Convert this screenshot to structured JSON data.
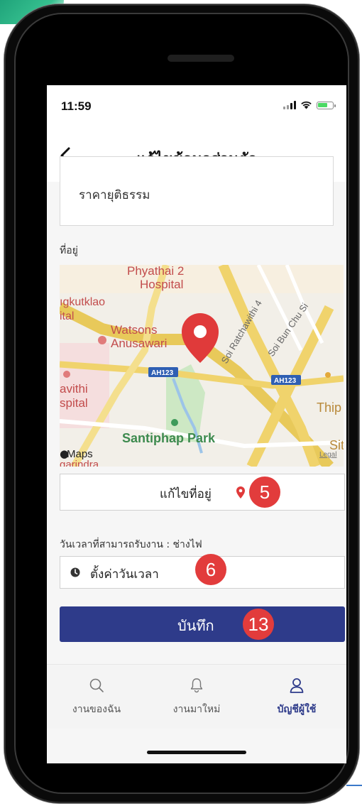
{
  "status_bar": {
    "time": "11:59",
    "battery_level": 0.7
  },
  "header": {
    "title": "แก้ไขข้อมูลส่วนตัว",
    "back_icon": "chevron-left-icon"
  },
  "description_box": {
    "value": "ราคายุติธรรม"
  },
  "address": {
    "label": "ที่อยู่",
    "map": {
      "labels": {
        "phyathai": "Phyathai 2",
        "hospital": "Hospital",
        "ngkutklao": "ıgkutklao",
        "ital": "ital",
        "watsons": "Watsons",
        "anusawari": "Anusawari",
        "ah123_a": "AH123",
        "ah123_b": "AH123",
        "avithi": "avithi",
        "spital": "spital",
        "santiphap": "Santiphap Park",
        "soi_ratchawithi": "Soi Ratchawithi 4",
        "soi_bun_chu_si": "Soi Bun Chu Si",
        "thip": "Thip",
        "sit": "Sit",
        "maps_brand": "Maps",
        "garindra": "garindra",
        "legal": "Legal"
      }
    },
    "edit_button_label": "แก้ไขที่อยู่",
    "step_badge": "5"
  },
  "availability": {
    "label": "วันเวลาที่สามารถรับงาน : ช่างไฟ",
    "placeholder": "ตั้งค่าวันเวลา",
    "step_badge": "6"
  },
  "save_button": {
    "label": "บันทึก",
    "step_badge": "13"
  },
  "tab_bar": {
    "tabs": [
      {
        "label": "งานของฉัน",
        "icon": "search-icon",
        "active": false
      },
      {
        "label": "งานมาใหม่",
        "icon": "bell-icon",
        "active": false
      },
      {
        "label": "บัญชีผู้ใช้",
        "icon": "user-icon",
        "active": true
      }
    ]
  },
  "colors": {
    "primary": "#2e3b8a",
    "badge": "#e23c3c",
    "pin": "#e03a3a"
  }
}
